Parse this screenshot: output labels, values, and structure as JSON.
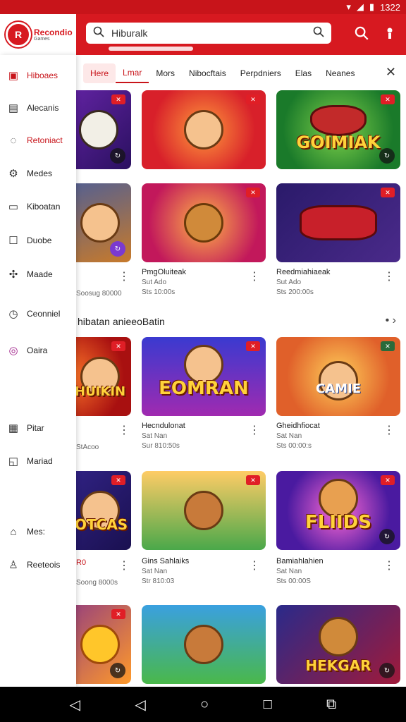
{
  "status": {
    "time": "1322"
  },
  "app": {
    "logo_text": "Recondio",
    "logo_sub": "Games"
  },
  "search": {
    "value": "Hiburalk"
  },
  "sidebar": {
    "items": [
      {
        "label": "Hiboaes",
        "icon": "home-icon"
      },
      {
        "label": "Alecanis",
        "icon": "grid-icon"
      },
      {
        "label": "Retoniact",
        "icon": "chat-icon"
      },
      {
        "label": "Medes",
        "icon": "gear-icon"
      },
      {
        "label": "Kiboatan",
        "icon": "cart-icon"
      },
      {
        "label": "Duobe",
        "icon": "square-icon"
      },
      {
        "label": "Maade",
        "icon": "puzzle-icon"
      },
      {
        "label": "Ceonniel",
        "icon": "clock-icon"
      },
      {
        "label": "Oaira",
        "icon": "circle-g-icon"
      },
      {
        "label": "Pitar",
        "icon": "calendar-icon"
      },
      {
        "label": "Mariad",
        "icon": "chart-icon"
      },
      {
        "label": "Mes:",
        "icon": "building-icon"
      },
      {
        "label": "Reeteois",
        "icon": "user-icon"
      }
    ]
  },
  "tabs": [
    "Here",
    "Lmar",
    "Mors",
    "Nibocftais",
    "Perpdniers",
    "Elas",
    "Neanes"
  ],
  "section_title": "hibatan anieeoBatin",
  "games_row1": [
    {
      "title": "",
      "sub": "",
      "art": ""
    },
    {
      "title": "",
      "sub": "",
      "art": ""
    },
    {
      "title": "",
      "sub": "",
      "art": "GOIMIAK"
    }
  ],
  "games_row2": [
    {
      "title": "",
      "art": ""
    },
    {
      "title": "PmgOluiteak",
      "line2": "Sut Ado",
      "line3": "Sts 10:00s",
      "art": ""
    },
    {
      "title": "Reedmiahiaeak",
      "line2": "Sut Ado",
      "line3": "Sts 200:00s",
      "art": ""
    }
  ],
  "row2_left": {
    "line3": "Soosug 80000"
  },
  "games_row3": [
    {
      "title": "",
      "line3": "StAcoo",
      "art": "HUIKIN"
    },
    {
      "title": "Hecndulonat",
      "line2": "Sat Nan",
      "line3": "Sur 810:50s",
      "art": "EOMRAN"
    },
    {
      "title": "Gheidhfiocat",
      "line2": "Sat Nan",
      "line3": "Sts 00:00:s",
      "art": "CAMIE"
    }
  ],
  "games_row4": [
    {
      "title": "R0",
      "line3": "Soong 8000s",
      "art": "OTCAS"
    },
    {
      "title": "Gins Sahlaiks",
      "line2": "Sat Nan",
      "line3": "Str 810:03",
      "art": ""
    },
    {
      "title": "Bamiahlahien",
      "line2": "Sat Nan",
      "line3": "Sts 00:00S",
      "art": "FLIIDS"
    }
  ],
  "games_row5": [
    {
      "art": ""
    },
    {
      "art": ""
    },
    {
      "art": "HEKGAR"
    }
  ],
  "colors": {
    "brand": "#d71920",
    "accent": "#c8141a"
  }
}
